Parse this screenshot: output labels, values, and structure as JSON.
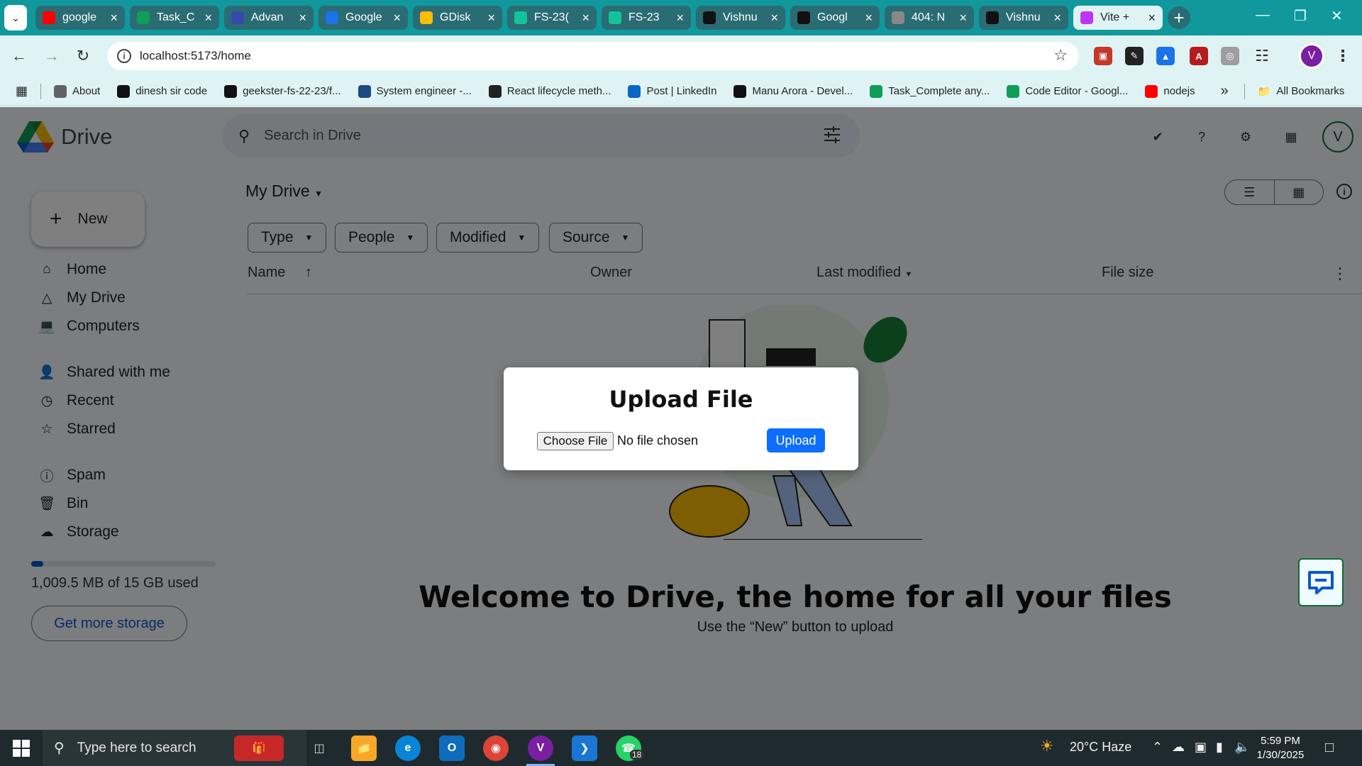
{
  "browser": {
    "tabs": [
      {
        "title": "google",
        "favicon": "youtube-icon",
        "color": "#ff0000"
      },
      {
        "title": "Task_C",
        "favicon": "sheets-icon",
        "color": "#0f9d58"
      },
      {
        "title": "Advan",
        "favicon": "pwskills-icon",
        "color": "#3949ab"
      },
      {
        "title": "Google",
        "favicon": "contacts-icon",
        "color": "#1a73e8"
      },
      {
        "title": "GDisk",
        "favicon": "drive-icon",
        "color": "#fbbc04"
      },
      {
        "title": "FS-23(",
        "favicon": "grammarly-icon",
        "color": "#15c39a"
      },
      {
        "title": "FS-23",
        "favicon": "grammarly-icon",
        "color": "#15c39a"
      },
      {
        "title": "Vishnu",
        "favicon": "github-icon",
        "color": "#111111"
      },
      {
        "title": "Googl",
        "favicon": "openai-icon",
        "color": "#111111"
      },
      {
        "title": "404: N",
        "favicon": "globe-icon",
        "color": "#888888"
      },
      {
        "title": "Vishnu",
        "favicon": "github-icon",
        "color": "#111111"
      },
      {
        "title": "Vite +",
        "favicon": "vite-icon",
        "color": "#bd34fe"
      }
    ],
    "url": "localhost:5173/home",
    "profile_initial": "V",
    "bookmarks": [
      {
        "label": "About",
        "icon": "google-apps-icon",
        "color": "#5f6368"
      },
      {
        "label": "dinesh sir code",
        "icon": "github-icon",
        "color": "#111111"
      },
      {
        "label": "geekster-fs-22-23/f...",
        "icon": "github-icon",
        "color": "#111111"
      },
      {
        "label": "System engineer -...",
        "icon": "unstop-icon",
        "color": "#1c4980"
      },
      {
        "label": "React lifecycle meth...",
        "icon": "react-icon",
        "color": "#222222"
      },
      {
        "label": "Post | LinkedIn",
        "icon": "linkedin-icon",
        "color": "#0a66c2"
      },
      {
        "label": "Manu Arora - Devel...",
        "icon": "ma-icon",
        "color": "#111111"
      },
      {
        "label": "Task_Complete any...",
        "icon": "sheets-icon",
        "color": "#0f9d58"
      },
      {
        "label": "Code Editor - Googl...",
        "icon": "sheets-icon",
        "color": "#0f9d58"
      },
      {
        "label": "nodejs",
        "icon": "youtube-icon",
        "color": "#ff0000"
      }
    ],
    "bookmarks_more": "»",
    "all_bookmarks": "All Bookmarks"
  },
  "app": {
    "logo_text": "Drive",
    "search_placeholder": "Search in Drive",
    "user_initial": "V",
    "new_label": "New",
    "nav": [
      {
        "label": "Home",
        "icon": "home-icon"
      },
      {
        "label": "My Drive",
        "icon": "my-drive-icon"
      },
      {
        "label": "Computers",
        "icon": "computers-icon"
      },
      {
        "label": "Shared with me",
        "icon": "shared-icon"
      },
      {
        "label": "Recent",
        "icon": "clock-icon"
      },
      {
        "label": "Starred",
        "icon": "star-icon"
      },
      {
        "label": "Spam",
        "icon": "spam-icon"
      },
      {
        "label": "Bin",
        "icon": "bin-icon"
      },
      {
        "label": "Storage",
        "icon": "cloud-icon"
      }
    ],
    "storage_used_fraction": 0.066,
    "storage_text": "1,009.5 MB of 15 GB used",
    "get_more_storage": "Get more storage",
    "title": "My Drive",
    "filters": [
      "Type",
      "People",
      "Modified",
      "Source"
    ],
    "columns": {
      "name": "Name",
      "owner": "Owner",
      "last_modified": "Last modified",
      "file_size": "File size"
    },
    "welcome_title": "Welcome to Drive, the home for all your files",
    "welcome_sub": "Use the “New” button to upload"
  },
  "modal": {
    "title": "Upload File",
    "choose_file": "Choose File",
    "no_file": "No file chosen",
    "upload": "Upload"
  },
  "taskbar": {
    "search_placeholder": "Type here to search",
    "weather": "20°C  Haze",
    "time": "5:59 PM",
    "date": "1/30/2025",
    "whatsapp_badge": "18"
  }
}
